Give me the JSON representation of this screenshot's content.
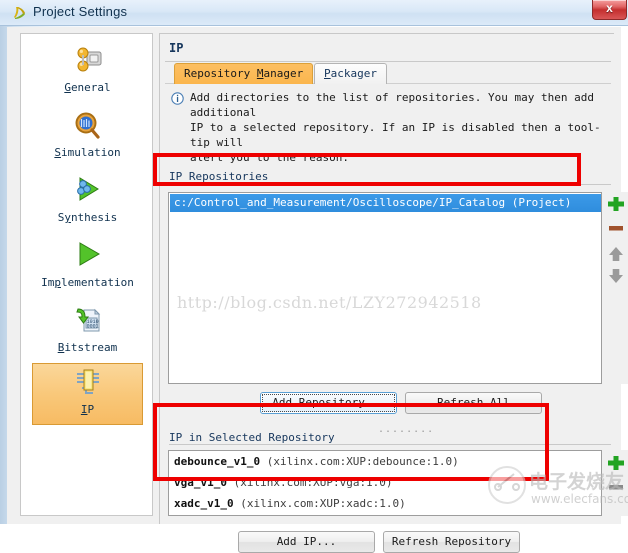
{
  "window": {
    "title": "Project Settings",
    "icon": "vivado-logo-icon",
    "close_label": "x"
  },
  "sidebar": {
    "items": [
      {
        "id": "general",
        "label": "General",
        "mnemonic": "G",
        "icon": "general-gear-icon",
        "selected": false
      },
      {
        "id": "simulation",
        "label": "Simulation",
        "mnemonic": "S",
        "icon": "magnifier-waveform-icon",
        "selected": false
      },
      {
        "id": "synthesis",
        "label": "Synthesis",
        "mnemonic": "y",
        "icon": "green-play-molecule-icon",
        "selected": false
      },
      {
        "id": "implementation",
        "label": "Implementation",
        "mnemonic": "p",
        "icon": "green-play-icon",
        "selected": false
      },
      {
        "id": "bitstream",
        "label": "Bitstream",
        "mnemonic": "B",
        "icon": "bitstream-file-icon",
        "selected": false
      },
      {
        "id": "ip",
        "label": "IP",
        "mnemonic": "I",
        "icon": "ip-chip-icon",
        "selected": true
      }
    ]
  },
  "panel": {
    "heading": "IP",
    "tabs": [
      {
        "id": "repository-manager",
        "label": "Repository Manager",
        "active": true
      },
      {
        "id": "packager",
        "label": "Packager",
        "active": false
      }
    ],
    "info": {
      "icon": "info-circle-icon",
      "text": "Add directories to the list of repositories. You may then add additional\nIP to a selected repository. If an IP is disabled then a tool-tip will\nalert you to the reason."
    },
    "repositories": {
      "section_label": "IP Repositories",
      "items": [
        {
          "path": "c:/Control_and_Measurement/Oscilloscope/IP_Catalog (Project)",
          "selected": true
        }
      ],
      "side_buttons": [
        {
          "id": "add",
          "icon": "plus-icon",
          "color": "#22a422"
        },
        {
          "id": "remove",
          "icon": "minus-icon",
          "color": "#a0522d"
        },
        {
          "id": "move-up",
          "icon": "arrow-up-icon",
          "color": "#9a9a9a"
        },
        {
          "id": "move-down",
          "icon": "arrow-down-icon",
          "color": "#9a9a9a"
        }
      ],
      "buttons": [
        {
          "id": "add-repository",
          "label": "Add Repository...",
          "focused": true
        },
        {
          "id": "refresh-all",
          "label": "Refresh All",
          "focused": false
        }
      ]
    },
    "selected_repository": {
      "section_label": "IP in Selected Repository",
      "items": [
        {
          "name": "debounce_v1_0",
          "vlnv": "(xilinx.com:XUP:debounce:1.0)"
        },
        {
          "name": "vga_v1_0",
          "vlnv": "(xilinx.com:XUP:vga:1.0)"
        },
        {
          "name": "xadc_v1_0",
          "vlnv": "(xilinx.com:XUP:xadc:1.0)"
        }
      ],
      "side_buttons": [
        {
          "id": "add-ip-side",
          "icon": "plus-icon",
          "color": "#22a422"
        },
        {
          "id": "remove-ip-side",
          "icon": "minus-icon",
          "color": "#8a8a8a"
        }
      ],
      "buttons": [
        {
          "id": "add-ip",
          "label": "Add IP...",
          "focused": false
        },
        {
          "id": "refresh-repository",
          "label": "Refresh Repository",
          "focused": false
        }
      ]
    },
    "splitter_dots": "........"
  },
  "watermarks": {
    "url": "http://blog.csdn.net/LZY272942518",
    "logo_cn": "电子发烧友",
    "logo_en": "www.elecfans.com"
  },
  "annotations": {
    "color": "#ee0000",
    "boxes": [
      {
        "id": "repo-path-highlight",
        "target": "selected-repository-row"
      },
      {
        "id": "ip-list-highlight",
        "target": "ip-in-selected-repository-list"
      }
    ]
  }
}
